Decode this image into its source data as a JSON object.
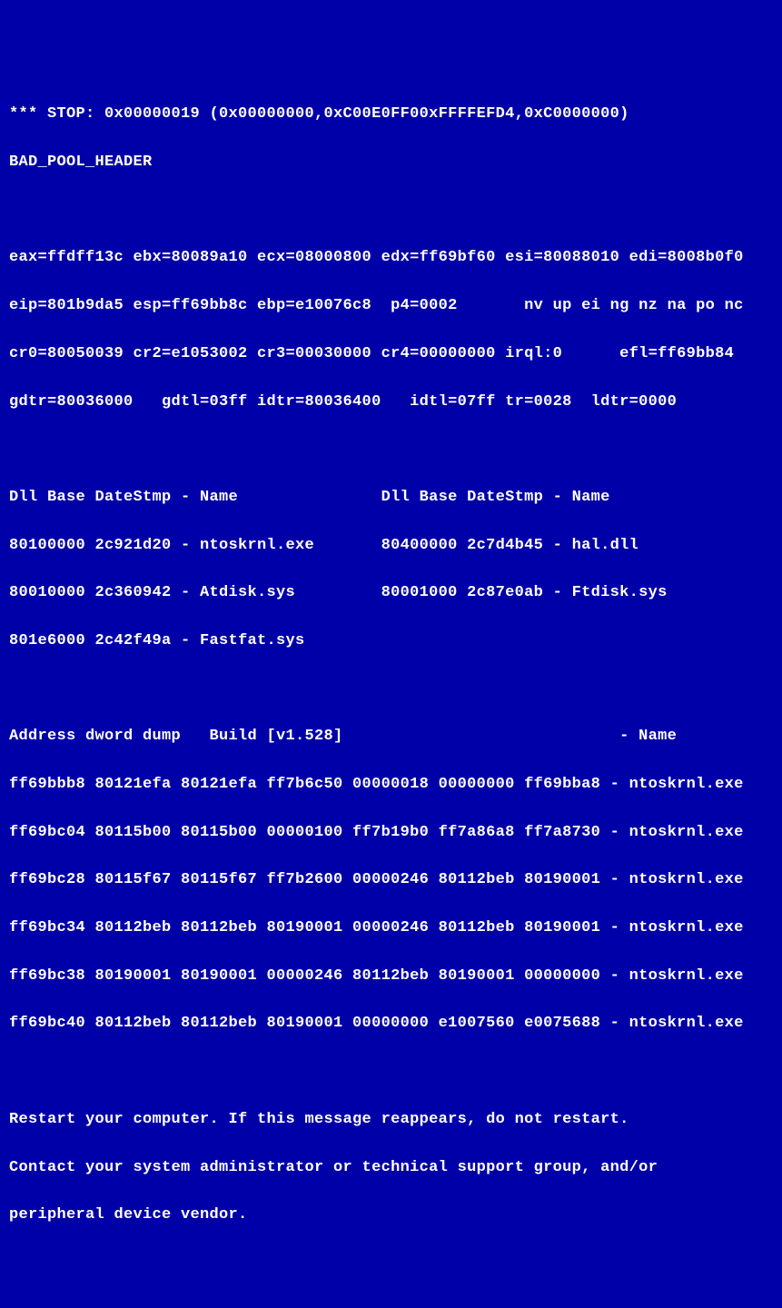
{
  "stop_line": "*** STOP: 0x00000019 (0x00000000,0xC00E0FF00xFFFFEFD4,0xC0000000)",
  "error_name": "BAD_POOL_HEADER",
  "registers": {
    "line1": "eax=ffdff13c ebx=80089a10 ecx=08000800 edx=ff69bf60 esi=80088010 edi=8008b0f0",
    "line2": "eip=801b9da5 esp=ff69bb8c ebp=e10076c8  p4=0002       nv up ei ng nz na po nc",
    "line3": "cr0=80050039 cr2=e1053002 cr3=00030000 cr4=00000000 irql:0      efl=ff69bb84",
    "line4": "gdtr=80036000   gdtl=03ff idtr=80036400   idtl=07ff tr=0028  ldtr=0000"
  },
  "dll_header": "Dll Base DateStmp - Name               Dll Base DateStmp - Name",
  "dll_rows": [
    "80100000 2c921d20 - ntoskrnl.exe       80400000 2c7d4b45 - hal.dll",
    "80010000 2c360942 - Atdisk.sys         80001000 2c87e0ab - Ftdisk.sys",
    "801e6000 2c42f49a - Fastfat.sys"
  ],
  "dump_header": "Address dword dump   Build [v1.528]                             - Name",
  "dump_rows": [
    "ff69bbb8 80121efa 80121efa ff7b6c50 00000018 00000000 ff69bba8 - ntoskrnl.exe",
    "ff69bc04 80115b00 80115b00 00000100 ff7b19b0 ff7a86a8 ff7a8730 - ntoskrnl.exe",
    "ff69bc28 80115f67 80115f67 ff7b2600 00000246 80112beb 80190001 - ntoskrnl.exe",
    "ff69bc34 80112beb 80112beb 80190001 00000246 80112beb 80190001 - ntoskrnl.exe",
    "ff69bc38 80190001 80190001 00000246 80112beb 80190001 00000000 - ntoskrnl.exe",
    "ff69bc40 80112beb 80112beb 80190001 00000000 e1007560 e0075688 - ntoskrnl.exe"
  ],
  "footer": {
    "line1": "Restart your computer. If this message reappears, do not restart.",
    "line2": "Contact your system administrator or technical support group, and/or",
    "line3": "peripheral device vendor."
  }
}
